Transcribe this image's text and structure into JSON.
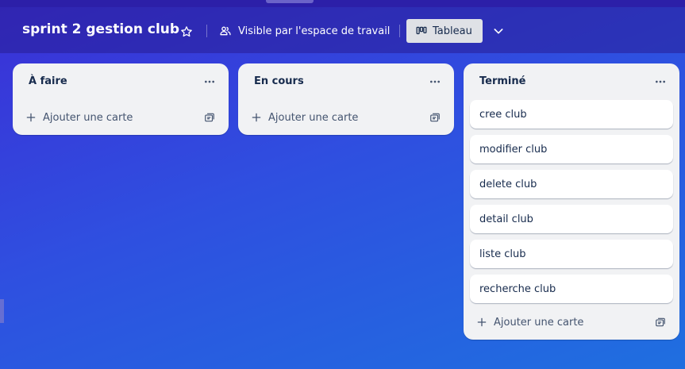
{
  "board": {
    "title": "sprint 2 gestion club",
    "visibility_label": "Visible par l'espace de travail",
    "view_label": "Tableau"
  },
  "icons": {
    "star": "star-icon",
    "visibility": "workspace-icon",
    "view": "board-view-icon",
    "dropdown": "chevron-down-icon",
    "list_menu": "more-horizontal-icon",
    "add": "plus-icon",
    "template": "card-template-icon"
  },
  "colors": {
    "background_start": "#3b2fd6",
    "background_end": "#1f6fe0",
    "list_bg": "#f1f2f4",
    "card_bg": "#ffffff",
    "text": "#172b4d"
  },
  "lists": [
    {
      "title": "À faire",
      "cards": [],
      "add_card_label": "Ajouter une carte"
    },
    {
      "title": "En cours",
      "cards": [],
      "add_card_label": "Ajouter une carte"
    },
    {
      "title": "Terminé",
      "cards": [
        "cree club",
        "modifier club",
        "delete club",
        "detail club",
        "liste club",
        "recherche club"
      ],
      "add_card_label": "Ajouter une carte"
    }
  ]
}
